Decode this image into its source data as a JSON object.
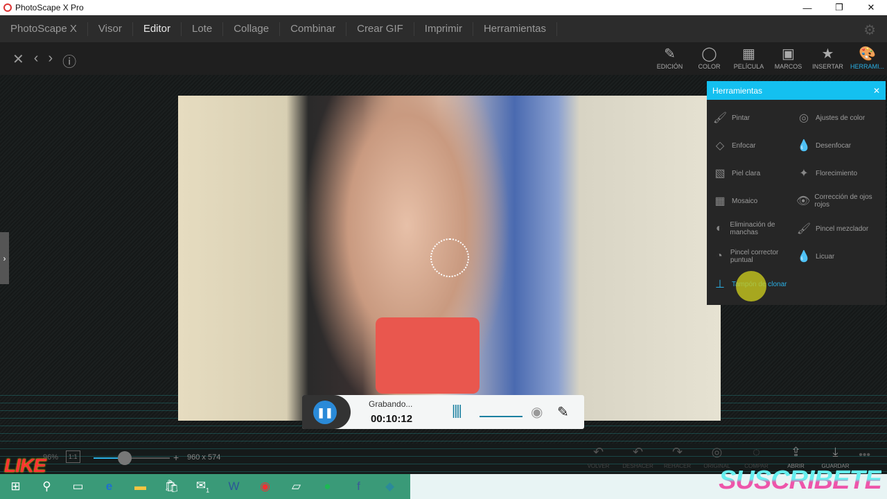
{
  "window": {
    "title": "PhotoScape X Pro",
    "minimize": "—",
    "maximize": "❐",
    "close": "✕"
  },
  "menu": [
    "PhotoScape X",
    "Visor",
    "Editor",
    "Lote",
    "Collage",
    "Combinar",
    "Crear GIF",
    "Imprimir",
    "Herramientas"
  ],
  "menu_active": "Editor",
  "toolbar": {
    "tools": [
      {
        "label": "EDICIÓN",
        "icon": "✎"
      },
      {
        "label": "COLOR",
        "icon": "◯"
      },
      {
        "label": "PELÍCULA",
        "icon": "▦"
      },
      {
        "label": "MARCOS",
        "icon": "▣"
      },
      {
        "label": "INSERTAR",
        "icon": "★"
      },
      {
        "label": "HERRAMI...",
        "icon": "🎨"
      }
    ],
    "active": "HERRAMI..."
  },
  "panel": {
    "title": "Herramientas",
    "items": [
      {
        "label": "Pintar",
        "icon": "🖌"
      },
      {
        "label": "Ajustes de color",
        "icon": "◎"
      },
      {
        "label": "Enfocar",
        "icon": "◇"
      },
      {
        "label": "Desenfocar",
        "icon": "💧"
      },
      {
        "label": "Piel clara",
        "icon": "▧"
      },
      {
        "label": "Florecimiento",
        "icon": "✦"
      },
      {
        "label": "Mosaico",
        "icon": "▦"
      },
      {
        "label": "Corrección de ojos rojos",
        "icon": "👁"
      },
      {
        "label": "Eliminación de manchas",
        "icon": "◐"
      },
      {
        "label": "Pincel mezclador",
        "icon": "🖌"
      },
      {
        "label": "Pincel corrector puntual",
        "icon": "◔"
      },
      {
        "label": "Licuar",
        "icon": "💧"
      },
      {
        "label": "Tampón de clonar",
        "icon": "⊥"
      }
    ],
    "active": "Tampón de clonar"
  },
  "recorder": {
    "status": "Grabando...",
    "time": "00:10:12"
  },
  "bottom": {
    "zoom": "96%",
    "one_to_one": "1:1",
    "dimensions": "960 x 574",
    "actions": [
      "VOLVER",
      "DESHACER",
      "REHACER",
      "ORIGINAL",
      "COMPAR",
      "ABRIR",
      "GUARDAR"
    ]
  },
  "overlay": {
    "like": "LIKE",
    "subscribe": "SUSCRIBETE"
  },
  "taskbar": {
    "notification_count": "1"
  }
}
